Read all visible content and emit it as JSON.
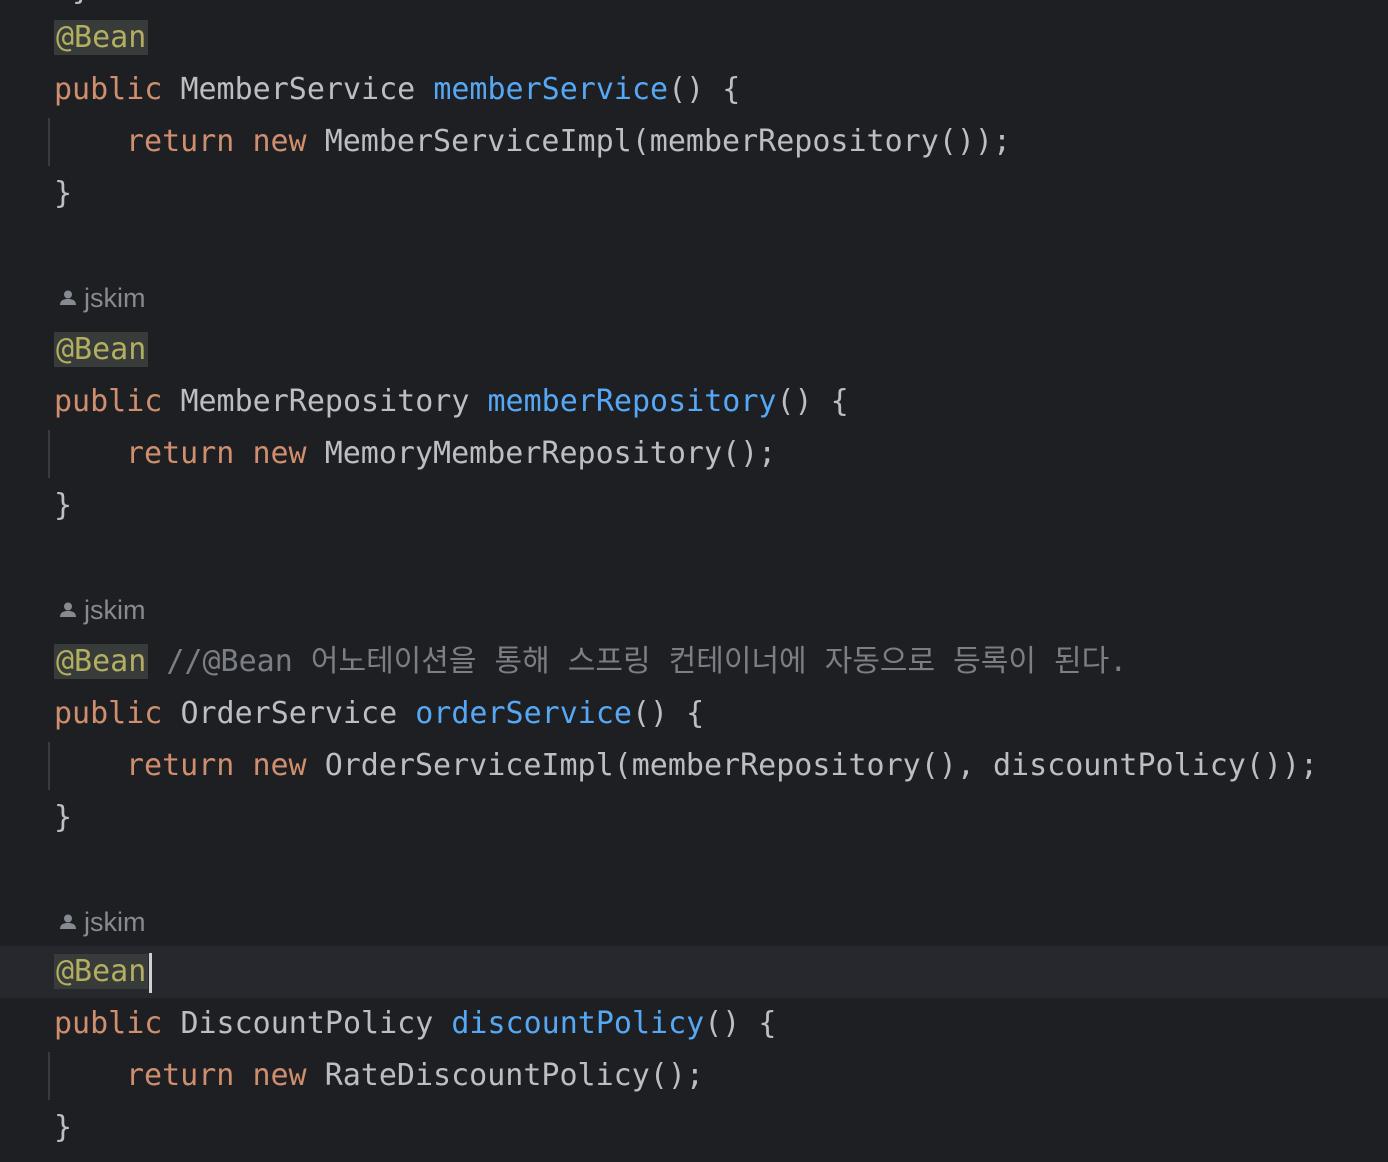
{
  "editor": {
    "top_cut": "}",
    "blocks": [
      {
        "author": "",
        "annotation": "@Bean",
        "comment": "",
        "sig_kw": "public",
        "sig_type": "MemberService",
        "sig_method": "memberService",
        "sig_tail": "() {",
        "ret_kw": "return",
        "new_kw": "new",
        "ret_expr": "MemberServiceImpl(memberRepository());",
        "close": "}"
      },
      {
        "author": "jskim",
        "annotation": "@Bean",
        "comment": "",
        "sig_kw": "public",
        "sig_type": "MemberRepository",
        "sig_method": "memberRepository",
        "sig_tail": "() {",
        "ret_kw": "return",
        "new_kw": "new",
        "ret_expr": "MemoryMemberRepository();",
        "close": "}"
      },
      {
        "author": "jskim",
        "annotation": "@Bean",
        "comment": "//@Bean 어노테이션을 통해 스프링 컨테이너에 자동으로 등록이 된다.",
        "sig_kw": "public",
        "sig_type": "OrderService",
        "sig_method": "orderService",
        "sig_tail": "() {",
        "ret_kw": "return",
        "new_kw": "new",
        "ret_expr": "OrderServiceImpl(memberRepository(), discountPolicy());",
        "close": "}"
      },
      {
        "author": "jskim",
        "annotation": "@Bean",
        "comment": "",
        "sig_kw": "public",
        "sig_type": "DiscountPolicy",
        "sig_method": "discountPolicy",
        "sig_tail": "() {",
        "ret_kw": "return",
        "new_kw": "new",
        "ret_expr": "RateDiscountPolicy();",
        "close": "}"
      }
    ]
  }
}
